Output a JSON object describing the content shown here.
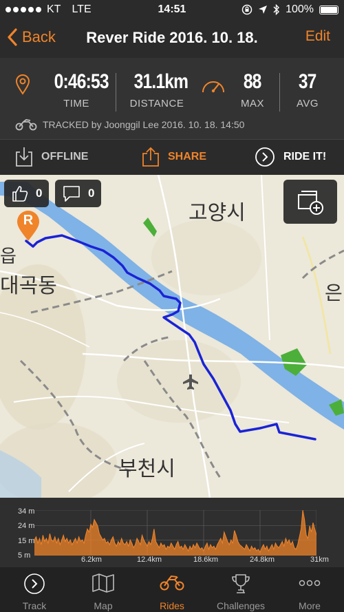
{
  "status": {
    "carrier": "KT",
    "network": "LTE",
    "time": "14:51",
    "battery": "100%"
  },
  "nav": {
    "back_label": "Back",
    "title": "Rever Ride 2016. 10. 18.",
    "edit_label": "Edit"
  },
  "stats": {
    "time_value": "0:46:53",
    "time_label": "TIME",
    "distance_value": "31.1km",
    "distance_label": "DISTANCE",
    "max_value": "88",
    "max_label": "MAX",
    "avg_value": "37",
    "avg_label": "AVG",
    "tracked_text": "TRACKED by  Joonggil Lee 2016. 10. 18. 14:50"
  },
  "actions": {
    "offline": "OFFLINE",
    "share": "SHARE",
    "ride": "RIDE IT!"
  },
  "map": {
    "likes": "0",
    "comments": "0",
    "labels": {
      "goyang": "고양시",
      "daegok": "대곡동",
      "bucheon": "부천시",
      "eup": "읍",
      "eun": "은"
    },
    "marker_letter": "R"
  },
  "elevation": {
    "y_labels": [
      "34 m",
      "24 m",
      "15 m",
      "5 m"
    ],
    "x_labels": [
      "6.2km",
      "12.4km",
      "18.6km",
      "24.8km",
      "31km"
    ],
    "ylim": [
      5,
      34
    ],
    "xlim": [
      0,
      31
    ],
    "profile": [
      15,
      17,
      13,
      16,
      12,
      18,
      14,
      16,
      13,
      19,
      15,
      14,
      17,
      13,
      16,
      12,
      15,
      18,
      14,
      16,
      13,
      15,
      12,
      14,
      16,
      13,
      17,
      14,
      15,
      13,
      18,
      22,
      20,
      25,
      23,
      28,
      26,
      24,
      19,
      17,
      15,
      16,
      13,
      14,
      12,
      15,
      17,
      13,
      11,
      14,
      12,
      16,
      13,
      12,
      14,
      11,
      15,
      13,
      10,
      12,
      16,
      14,
      12,
      18,
      15,
      13,
      11,
      14,
      12,
      16,
      22,
      14,
      12,
      10,
      13,
      11,
      12,
      9,
      11,
      10,
      13,
      11,
      9,
      12,
      14,
      10,
      11,
      9,
      12,
      10,
      8,
      11,
      9,
      12,
      10,
      13,
      11,
      9,
      10,
      8,
      11,
      13,
      9,
      12,
      10,
      11,
      9,
      12,
      14,
      16,
      13,
      20,
      17,
      14,
      12,
      15,
      13,
      21,
      18,
      14,
      12,
      11,
      10,
      9,
      12,
      10,
      8,
      11,
      9,
      10,
      8,
      9,
      7,
      10,
      12,
      9,
      11,
      8,
      10,
      12,
      9,
      13,
      11,
      10,
      12,
      14,
      11,
      16,
      13,
      15,
      12,
      14,
      10,
      9,
      12,
      17,
      22,
      35,
      28,
      18,
      16,
      24,
      20,
      26,
      22,
      18
    ]
  },
  "tabs": [
    {
      "label": "Track",
      "active": false
    },
    {
      "label": "Map",
      "active": false
    },
    {
      "label": "Rides",
      "active": true
    },
    {
      "label": "Challenges",
      "active": false
    },
    {
      "label": "More",
      "active": false
    }
  ],
  "colors": {
    "accent": "#f0842a",
    "route": "#1a23d6",
    "river": "#7fb2e6",
    "park": "#4caf3a"
  }
}
